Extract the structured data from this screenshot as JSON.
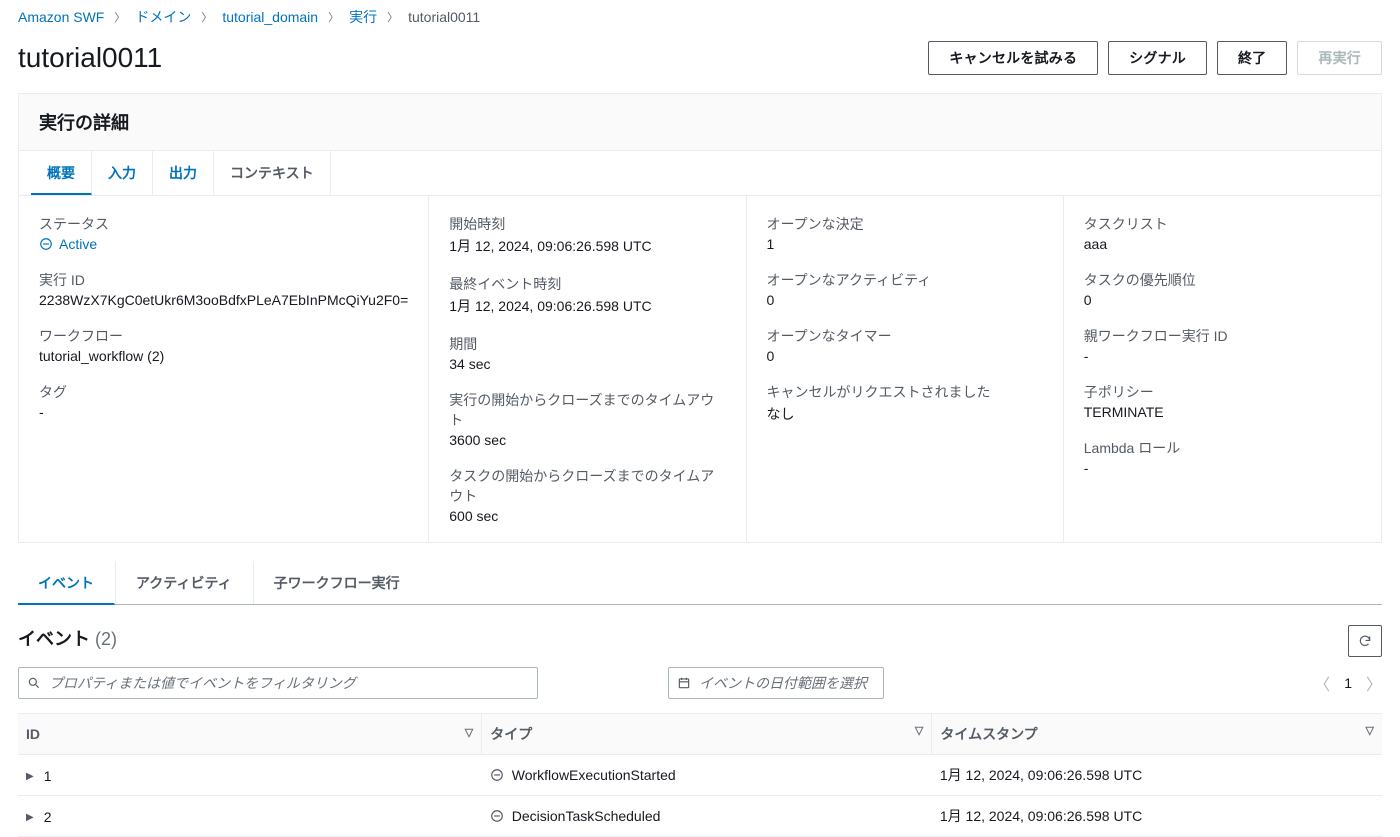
{
  "breadcrumb": [
    {
      "label": "Amazon SWF",
      "link": true
    },
    {
      "label": "ドメイン",
      "link": true
    },
    {
      "label": "tutorial_domain",
      "link": true
    },
    {
      "label": "実行",
      "link": true
    },
    {
      "label": "tutorial0011",
      "link": false
    }
  ],
  "page_title": "tutorial0011",
  "actions": {
    "try_cancel": "キャンセルを試みる",
    "signal": "シグナル",
    "terminate": "終了",
    "rerun": "再実行"
  },
  "details": {
    "heading": "実行の詳細",
    "tabs": {
      "overview": "概要",
      "input": "入力",
      "output": "出力",
      "context": "コンテキスト"
    },
    "col1": {
      "status_label": "ステータス",
      "status_value": "Active",
      "exec_id_label": "実行 ID",
      "exec_id_value": "2238WzX7KgC0etUkr6M3ooBdfxPLeA7EbInPMcQiYu2F0=",
      "workflow_label": "ワークフロー",
      "workflow_value": "tutorial_workflow (2)",
      "tags_label": "タグ",
      "tags_value": "-"
    },
    "col2": {
      "start_label": "開始時刻",
      "start_value": "1月 12, 2024, 09:06:26.598 UTC",
      "last_event_label": "最終イベント時刻",
      "last_event_value": "1月 12, 2024, 09:06:26.598 UTC",
      "duration_label": "期間",
      "duration_value": "34 sec",
      "exec_timeout_label": "実行の開始からクローズまでのタイムアウト",
      "exec_timeout_value": "3600 sec",
      "task_timeout_label": "タスクの開始からクローズまでのタイムアウト",
      "task_timeout_value": "600 sec"
    },
    "col3": {
      "open_decisions_label": "オープンな決定",
      "open_decisions_value": "1",
      "open_activities_label": "オープンなアクティビティ",
      "open_activities_value": "0",
      "open_timers_label": "オープンなタイマー",
      "open_timers_value": "0",
      "cancel_req_label": "キャンセルがリクエストされました",
      "cancel_req_value": "なし"
    },
    "col4": {
      "tasklist_label": "タスクリスト",
      "tasklist_value": "aaa",
      "task_priority_label": "タスクの優先順位",
      "task_priority_value": "0",
      "parent_wf_label": "親ワークフロー実行 ID",
      "parent_wf_value": "-",
      "child_policy_label": "子ポリシー",
      "child_policy_value": "TERMINATE",
      "lambda_role_label": "Lambda ロール",
      "lambda_role_value": "-"
    }
  },
  "subtabs": {
    "events": "イベント",
    "activities": "アクティビティ",
    "child_wf": "子ワークフロー実行"
  },
  "events": {
    "title": "イベント",
    "count": "(2)",
    "search_placeholder": "プロパティまたは値でイベントをフィルタリング",
    "date_placeholder": "イベントの日付範囲を選択",
    "page": "1",
    "columns": {
      "id": "ID",
      "type": "タイプ",
      "timestamp": "タイムスタンプ"
    },
    "rows": [
      {
        "id": "1",
        "type": "WorkflowExecutionStarted",
        "timestamp": "1月 12, 2024, 09:06:26.598 UTC"
      },
      {
        "id": "2",
        "type": "DecisionTaskScheduled",
        "timestamp": "1月 12, 2024, 09:06:26.598 UTC"
      }
    ]
  }
}
